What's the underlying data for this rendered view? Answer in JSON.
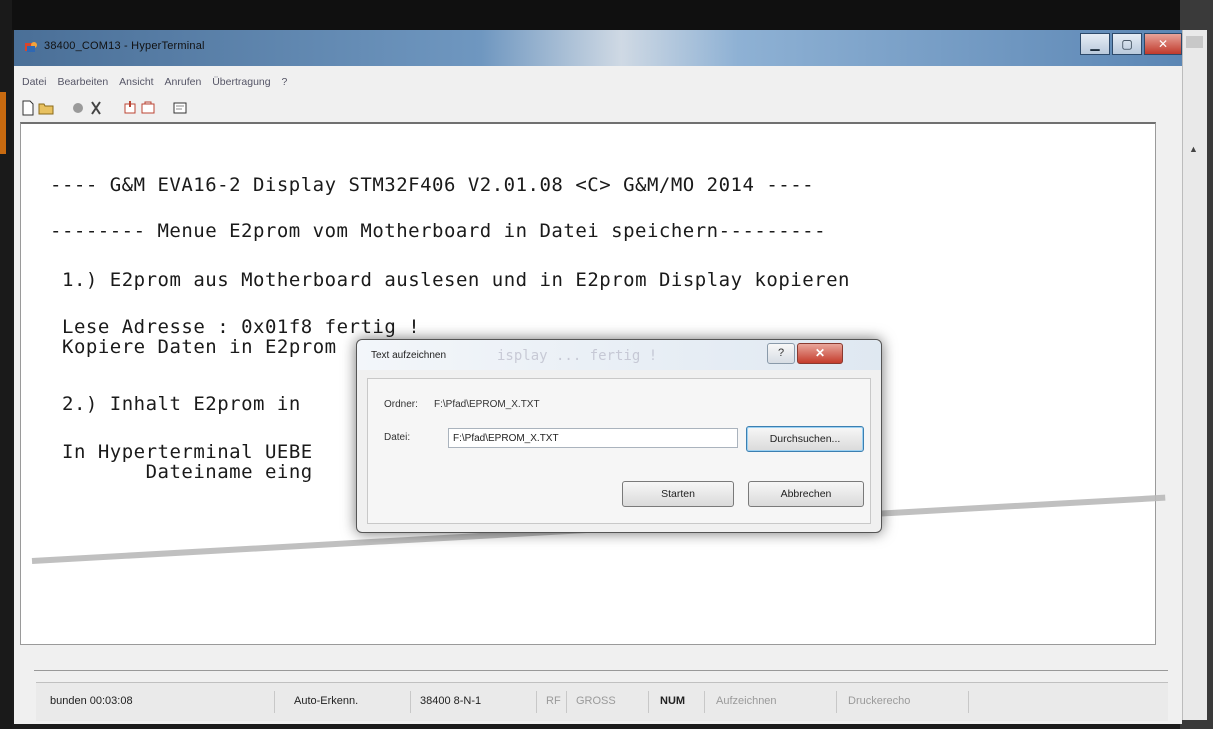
{
  "window": {
    "title": "38400_COM13 - HyperTerminal",
    "controls": {
      "minimize": "▁",
      "maximize": "▢",
      "close": "✕"
    }
  },
  "menu": [
    "Datei",
    "Bearbeiten",
    "Ansicht",
    "Anrufen",
    "Übertragung",
    "?"
  ],
  "toolbar": [
    "new-file-icon",
    "open-folder-icon",
    "phone-icon",
    "disconnect-icon",
    "send-icon",
    "receive-icon",
    "properties-icon"
  ],
  "terminal": {
    "lines": [
      "---- G&M EVA16-2 Display STM32F406 V2.01.08 <C> G&M/MO 2014 ----",
      "-------- Menue E2prom vom Motherboard in Datei speichern---------",
      "1.) E2prom aus Motherboard auslesen und in E2prom Display kopieren",
      "Lese Adresse : 0x01f8 fertig !",
      "Kopiere Daten in E2prom",
      "2.) Inhalt E2prom in",
      "In Hyperterminal UEBE",
      "       Dateiname eing"
    ]
  },
  "dialog": {
    "title": "Text aufzeichnen",
    "ghost_text": "isplay ... fertig !",
    "help": "?",
    "close": "✕",
    "folder_label": "Ordner:",
    "folder_value": "F:\\Pfad\\EPROM_X.TXT",
    "file_label": "Datei:",
    "file_value": "F:\\Pfad\\EPROM_X.TXT",
    "browse_button": "Durchsuchen...",
    "start_button": "Starten",
    "cancel_button": "Abbrechen"
  },
  "status": {
    "connected": "bunden 00:03:08",
    "autodetect": "Auto-Erkenn.",
    "params": "38400 8-N-1",
    "rf": "RF",
    "caps": "GROSS",
    "num": "NUM",
    "capture": "Aufzeichnen",
    "print": "Druckerecho"
  }
}
